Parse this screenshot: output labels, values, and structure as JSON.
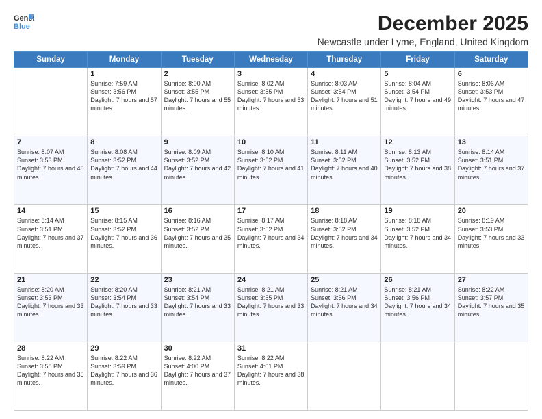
{
  "logo": {
    "line1": "General",
    "line2": "Blue"
  },
  "title": "December 2025",
  "location": "Newcastle under Lyme, England, United Kingdom",
  "days_of_week": [
    "Sunday",
    "Monday",
    "Tuesday",
    "Wednesday",
    "Thursday",
    "Friday",
    "Saturday"
  ],
  "weeks": [
    [
      {
        "day": "",
        "sunrise": "",
        "sunset": "",
        "daylight": ""
      },
      {
        "day": "1",
        "sunrise": "Sunrise: 7:59 AM",
        "sunset": "Sunset: 3:56 PM",
        "daylight": "Daylight: 7 hours and 57 minutes."
      },
      {
        "day": "2",
        "sunrise": "Sunrise: 8:00 AM",
        "sunset": "Sunset: 3:55 PM",
        "daylight": "Daylight: 7 hours and 55 minutes."
      },
      {
        "day": "3",
        "sunrise": "Sunrise: 8:02 AM",
        "sunset": "Sunset: 3:55 PM",
        "daylight": "Daylight: 7 hours and 53 minutes."
      },
      {
        "day": "4",
        "sunrise": "Sunrise: 8:03 AM",
        "sunset": "Sunset: 3:54 PM",
        "daylight": "Daylight: 7 hours and 51 minutes."
      },
      {
        "day": "5",
        "sunrise": "Sunrise: 8:04 AM",
        "sunset": "Sunset: 3:54 PM",
        "daylight": "Daylight: 7 hours and 49 minutes."
      },
      {
        "day": "6",
        "sunrise": "Sunrise: 8:06 AM",
        "sunset": "Sunset: 3:53 PM",
        "daylight": "Daylight: 7 hours and 47 minutes."
      }
    ],
    [
      {
        "day": "7",
        "sunrise": "Sunrise: 8:07 AM",
        "sunset": "Sunset: 3:53 PM",
        "daylight": "Daylight: 7 hours and 45 minutes."
      },
      {
        "day": "8",
        "sunrise": "Sunrise: 8:08 AM",
        "sunset": "Sunset: 3:52 PM",
        "daylight": "Daylight: 7 hours and 44 minutes."
      },
      {
        "day": "9",
        "sunrise": "Sunrise: 8:09 AM",
        "sunset": "Sunset: 3:52 PM",
        "daylight": "Daylight: 7 hours and 42 minutes."
      },
      {
        "day": "10",
        "sunrise": "Sunrise: 8:10 AM",
        "sunset": "Sunset: 3:52 PM",
        "daylight": "Daylight: 7 hours and 41 minutes."
      },
      {
        "day": "11",
        "sunrise": "Sunrise: 8:11 AM",
        "sunset": "Sunset: 3:52 PM",
        "daylight": "Daylight: 7 hours and 40 minutes."
      },
      {
        "day": "12",
        "sunrise": "Sunrise: 8:13 AM",
        "sunset": "Sunset: 3:52 PM",
        "daylight": "Daylight: 7 hours and 38 minutes."
      },
      {
        "day": "13",
        "sunrise": "Sunrise: 8:14 AM",
        "sunset": "Sunset: 3:51 PM",
        "daylight": "Daylight: 7 hours and 37 minutes."
      }
    ],
    [
      {
        "day": "14",
        "sunrise": "Sunrise: 8:14 AM",
        "sunset": "Sunset: 3:51 PM",
        "daylight": "Daylight: 7 hours and 37 minutes."
      },
      {
        "day": "15",
        "sunrise": "Sunrise: 8:15 AM",
        "sunset": "Sunset: 3:52 PM",
        "daylight": "Daylight: 7 hours and 36 minutes."
      },
      {
        "day": "16",
        "sunrise": "Sunrise: 8:16 AM",
        "sunset": "Sunset: 3:52 PM",
        "daylight": "Daylight: 7 hours and 35 minutes."
      },
      {
        "day": "17",
        "sunrise": "Sunrise: 8:17 AM",
        "sunset": "Sunset: 3:52 PM",
        "daylight": "Daylight: 7 hours and 34 minutes."
      },
      {
        "day": "18",
        "sunrise": "Sunrise: 8:18 AM",
        "sunset": "Sunset: 3:52 PM",
        "daylight": "Daylight: 7 hours and 34 minutes."
      },
      {
        "day": "19",
        "sunrise": "Sunrise: 8:18 AM",
        "sunset": "Sunset: 3:52 PM",
        "daylight": "Daylight: 7 hours and 34 minutes."
      },
      {
        "day": "20",
        "sunrise": "Sunrise: 8:19 AM",
        "sunset": "Sunset: 3:53 PM",
        "daylight": "Daylight: 7 hours and 33 minutes."
      }
    ],
    [
      {
        "day": "21",
        "sunrise": "Sunrise: 8:20 AM",
        "sunset": "Sunset: 3:53 PM",
        "daylight": "Daylight: 7 hours and 33 minutes."
      },
      {
        "day": "22",
        "sunrise": "Sunrise: 8:20 AM",
        "sunset": "Sunset: 3:54 PM",
        "daylight": "Daylight: 7 hours and 33 minutes."
      },
      {
        "day": "23",
        "sunrise": "Sunrise: 8:21 AM",
        "sunset": "Sunset: 3:54 PM",
        "daylight": "Daylight: 7 hours and 33 minutes."
      },
      {
        "day": "24",
        "sunrise": "Sunrise: 8:21 AM",
        "sunset": "Sunset: 3:55 PM",
        "daylight": "Daylight: 7 hours and 33 minutes."
      },
      {
        "day": "25",
        "sunrise": "Sunrise: 8:21 AM",
        "sunset": "Sunset: 3:56 PM",
        "daylight": "Daylight: 7 hours and 34 minutes."
      },
      {
        "day": "26",
        "sunrise": "Sunrise: 8:21 AM",
        "sunset": "Sunset: 3:56 PM",
        "daylight": "Daylight: 7 hours and 34 minutes."
      },
      {
        "day": "27",
        "sunrise": "Sunrise: 8:22 AM",
        "sunset": "Sunset: 3:57 PM",
        "daylight": "Daylight: 7 hours and 35 minutes."
      }
    ],
    [
      {
        "day": "28",
        "sunrise": "Sunrise: 8:22 AM",
        "sunset": "Sunset: 3:58 PM",
        "daylight": "Daylight: 7 hours and 35 minutes."
      },
      {
        "day": "29",
        "sunrise": "Sunrise: 8:22 AM",
        "sunset": "Sunset: 3:59 PM",
        "daylight": "Daylight: 7 hours and 36 minutes."
      },
      {
        "day": "30",
        "sunrise": "Sunrise: 8:22 AM",
        "sunset": "Sunset: 4:00 PM",
        "daylight": "Daylight: 7 hours and 37 minutes."
      },
      {
        "day": "31",
        "sunrise": "Sunrise: 8:22 AM",
        "sunset": "Sunset: 4:01 PM",
        "daylight": "Daylight: 7 hours and 38 minutes."
      },
      {
        "day": "",
        "sunrise": "",
        "sunset": "",
        "daylight": ""
      },
      {
        "day": "",
        "sunrise": "",
        "sunset": "",
        "daylight": ""
      },
      {
        "day": "",
        "sunrise": "",
        "sunset": "",
        "daylight": ""
      }
    ]
  ]
}
